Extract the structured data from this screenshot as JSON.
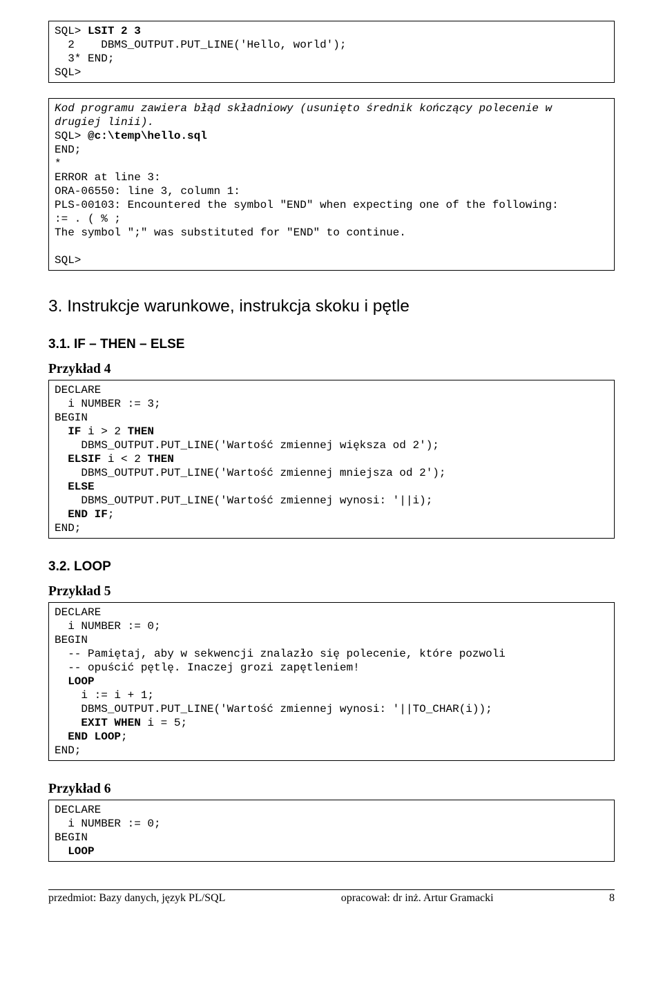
{
  "code1_l1a": "SQL> ",
  "code1_l1b": "LSIT 2 3",
  "code1_l2": "  2    DBMS_OUTPUT.PUT_LINE('Hello, world');",
  "code1_l3": "  3* ",
  "code1_l4": "SQL>",
  "code2_l1": "Kod programu zawiera błąd składniowy (usunięto średnik kończący polecenie w",
  "code2_l2": "drugiej linii).",
  "code2_l3a": "SQL> ",
  "code2_l3b": "@c:\\temp\\hello.sql",
  "code2_l4": "*",
  "code2_l5": "ERROR at line 3:",
  "code2_l6": "ORA-06550: line 3, column 1:",
  "code2_l7": "PLS-00103: Encountered the symbol \"END\" when expecting one of the following:",
  "code2_l8": ":= . ( % ;",
  "code2_l9": "The symbol \";\" was substituted for \"END\" to continue.",
  "code2_l10": "SQL>",
  "h2": "3. Instrukcje warunkowe, instrukcja skoku i pętle",
  "h3_1": "3.1. IF – THEN – ELSE",
  "ex4": "Przykład 4",
  "c4_l1": "DECLARE",
  "c4_l2": "  i NUMBER := 3;",
  "c4_l3": "BEGIN",
  "c4_l4a": "  ",
  "c4_l4b": "IF",
  "c4_l4c": " i > 2 ",
  "c4_l4d": "THEN",
  "c4_l5": "    DBMS_OUTPUT.PUT_LINE('Wartość zmiennej większa od 2');",
  "c4_l6a": "  ",
  "c4_l6b": "ELSIF",
  "c4_l6c": " i < 2 ",
  "c4_l6d": "THEN",
  "c4_l7": "    DBMS_OUTPUT.PUT_LINE('Wartość zmiennej mniejsza od 2');",
  "c4_l8a": "  ",
  "c4_l8b": "ELSE",
  "c4_l9": "    DBMS_OUTPUT.PUT_LINE('Wartość zmiennej wynosi: '||i);",
  "c4_l10a": "  ",
  "c4_l10b": "END IF",
  "c4_l10c": ";",
  "c4_l11": "END;",
  "h3_2": "3.2. LOOP",
  "ex5": "Przykład 5",
  "c5_l1": "DECLARE",
  "c5_l2": "  i NUMBER := 0;",
  "c5_l3": "BEGIN",
  "c5_l4": "  -- Pamiętaj, aby w sekwencji znalazło się polecenie, które pozwoli",
  "c5_l5": "  -- opuścić pętlę. Inaczej grozi zapętleniem!",
  "c5_l6a": "  ",
  "c5_l6b": "LOOP",
  "c5_l7": "    i := i + 1;",
  "c5_l8": "    DBMS_OUTPUT.PUT_LINE('Wartość zmiennej wynosi: '||TO_CHAR(i));",
  "c5_l9a": "    ",
  "c5_l9b": "EXIT WHEN",
  "c5_l9c": " i = 5;",
  "c5_l10a": "  ",
  "c5_l10b": "END LOOP",
  "c5_l10c": ";",
  "c5_l11": "END;",
  "ex6": "Przykład 6",
  "c6_l1": "DECLARE",
  "c6_l2": "  i NUMBER := 0;",
  "c6_l3": "BEGIN",
  "c6_l4a": "  ",
  "c6_l4b": "LOOP",
  "footer_left": "przedmiot: Bazy danych, język PL/SQL",
  "footer_mid": "opracował: dr inż. Artur Gramacki",
  "footer_right": "8"
}
